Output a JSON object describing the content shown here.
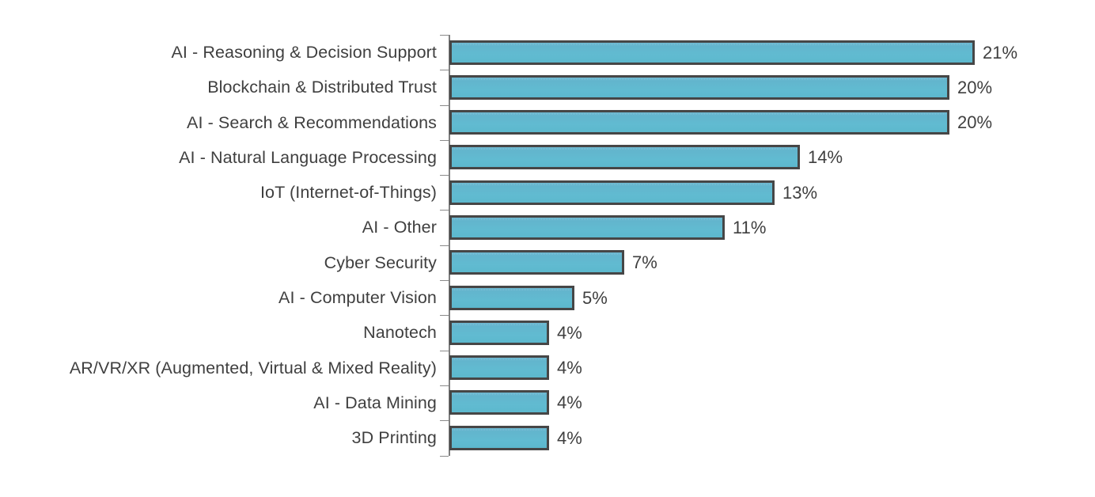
{
  "chart_data": {
    "type": "bar",
    "orientation": "horizontal",
    "title": "",
    "subtitle": "",
    "xlabel": "",
    "ylabel": "",
    "xlim": [
      0,
      22.5
    ],
    "grid": false,
    "legend": false,
    "value_suffix": "%",
    "categories": [
      "AI - Reasoning & Decision Support",
      "Blockchain & Distributed Trust",
      "AI - Search & Recommendations",
      "AI - Natural Language Processing",
      "IoT (Internet-of-Things)",
      "AI - Other",
      "Cyber Security",
      "AI - Computer Vision",
      "Nanotech",
      "AR/VR/XR (Augmented, Virtual & Mixed Reality)",
      "AI - Data Mining",
      "3D Printing"
    ],
    "values": [
      21,
      20,
      20,
      14,
      13,
      11,
      7,
      5,
      4,
      4,
      4,
      4
    ],
    "data_labels": [
      "21%",
      "20%",
      "20%",
      "14%",
      "13%",
      "11%",
      "7%",
      "5%",
      "4%",
      "4%",
      "4%",
      "4%"
    ],
    "colors": {
      "bar_fill_top": "#6fb9d2",
      "bar_fill_bottom": "#5cb8cd",
      "bar_border": "#464646",
      "text": "#3f3f3f",
      "axis": "#7f7f7f",
      "background": "#ffffff"
    }
  }
}
